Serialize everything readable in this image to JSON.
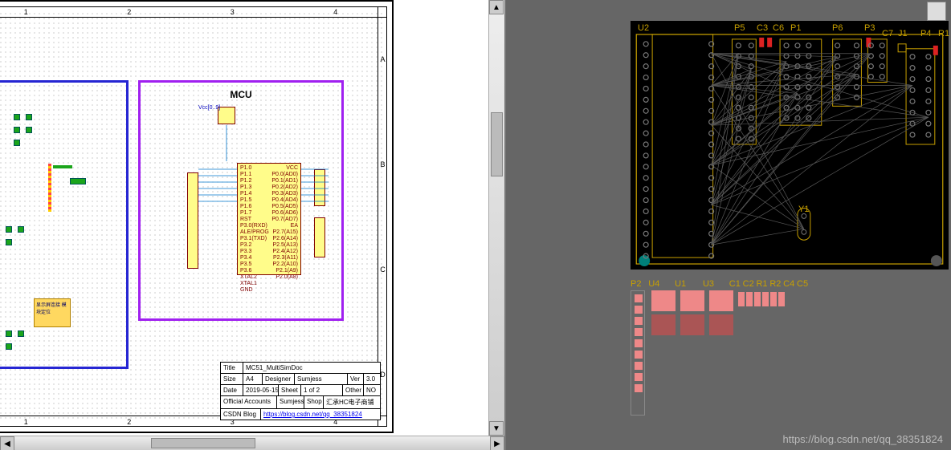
{
  "watermark": "https://blog.csdn.net/qq_38351824",
  "schematic": {
    "ruler_cols": [
      "1",
      "2",
      "3",
      "4"
    ],
    "ruler_rows": [
      "A",
      "B",
      "C",
      "D"
    ],
    "mcu_title": "MCU",
    "vcc_label": "Vcc[0..9]",
    "chip_left_pins": [
      "P1.0",
      "P1.1",
      "P1.2",
      "P1.3",
      "P1.4",
      "P1.5",
      "P1.6",
      "P1.7",
      "RST",
      "P3.0(RXD)",
      "ALE/PROG",
      "P3.1(TXD)",
      "P3.2",
      "P3.3",
      "P3.4",
      "P3.5",
      "P3.6",
      "XTAL2",
      "XTAL1",
      "GND"
    ],
    "chip_right_pins": [
      "VCC",
      "P0.0(AD0)",
      "P0.1(AD1)",
      "P0.2(AD2)",
      "P0.3(AD3)",
      "P0.4(AD4)",
      "P0.5(AD5)",
      "P0.6(AD6)",
      "P0.7(AD7)",
      "EA",
      "P2.7(A15)",
      "P2.6(A14)",
      "P2.5(A13)",
      "P2.4(A12)",
      "P2.3(A11)",
      "P2.2(A10)",
      "P2.1(A9)",
      "P2.0(A8)"
    ],
    "orange_text": "显示屏连接\n模块定位",
    "title_block": {
      "title_hdr": "Title",
      "title_val": "MC51_MultiSimDoc",
      "size_hdr": "Size",
      "size_val": "A4",
      "designer_hdr": "Designer",
      "designer_val": "Sumjess",
      "ver_hdr": "Ver",
      "ver_val": "3.0",
      "date_hdr": "Date",
      "date_val": "2019-05-15",
      "sheet_hdr": "Sheet",
      "sheet_val": "1   of   2",
      "other_hdr": "Other",
      "other_val": "NO",
      "acr_hdr": "Official Accounts",
      "acr_val": "Sumjess",
      "shop_hdr": "Shop",
      "shop_val": "汇承HC电子商铺",
      "blog_hdr": "CSDN Blog",
      "blog_val": "https://blog.csdn.net/qq_38351824"
    }
  },
  "pcb": {
    "top_refs": [
      "U2",
      "P5",
      "C3",
      "C6",
      "P1",
      "P6",
      "P3",
      "C7",
      "J1",
      "P4",
      "R1"
    ],
    "y1_ref": "Y1",
    "bottom_refs": [
      "P2",
      "U4",
      "U1",
      "U3",
      "C1",
      "C2",
      "R1",
      "R2",
      "C4",
      "C5"
    ]
  }
}
